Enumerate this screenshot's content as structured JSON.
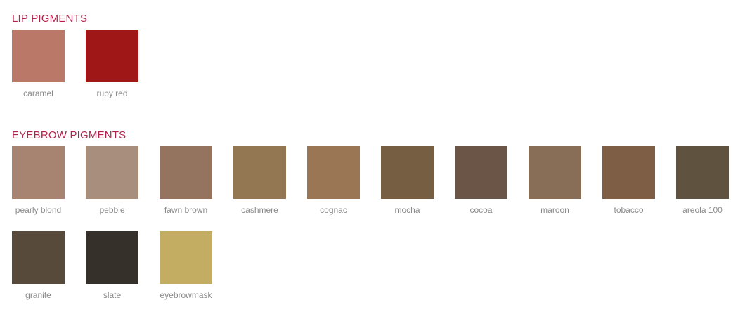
{
  "accent_color": "#b1244a",
  "sections": [
    {
      "title": "LIP PIGMENTS",
      "pigments": [
        {
          "name": "caramel",
          "color": "#b97868"
        },
        {
          "name": "ruby red",
          "color": "#a01717"
        }
      ]
    },
    {
      "title": "EYEBROW PIGMENTS",
      "pigments": [
        {
          "name": "pearly blond",
          "color": "#a78372"
        },
        {
          "name": "pebble",
          "color": "#a88e7c"
        },
        {
          "name": "fawn brown",
          "color": "#95745f"
        },
        {
          "name": "cashmere",
          "color": "#937753"
        },
        {
          "name": "cognac",
          "color": "#9a7655"
        },
        {
          "name": "mocha",
          "color": "#765e43"
        },
        {
          "name": "cocoa",
          "color": "#6a5547"
        },
        {
          "name": "maroon",
          "color": "#896e57"
        },
        {
          "name": "tobacco",
          "color": "#7e5e44"
        },
        {
          "name": "areola 100",
          "color": "#5f523f"
        },
        {
          "name": "granite",
          "color": "#574a3b"
        },
        {
          "name": "slate",
          "color": "#35302a"
        },
        {
          "name": "eyebrowmask",
          "color": "#c3ad63"
        }
      ]
    }
  ]
}
